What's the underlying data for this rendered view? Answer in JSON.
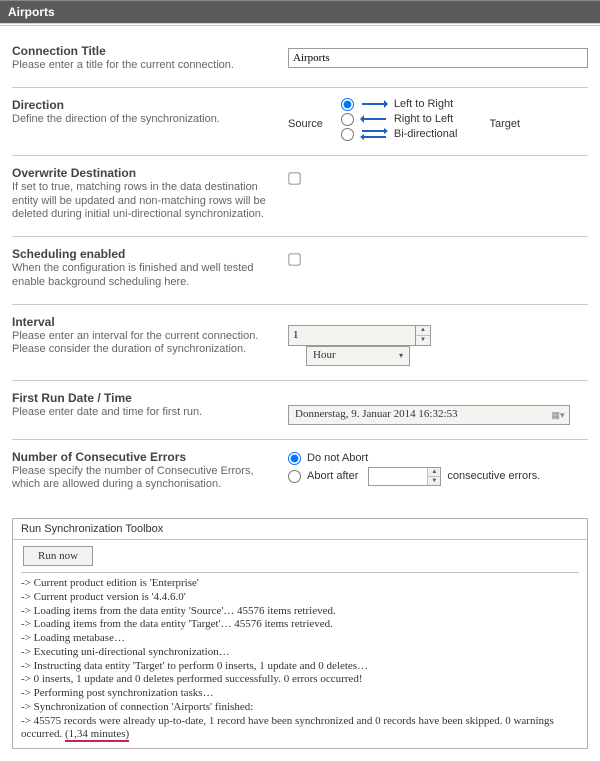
{
  "title": "Airports",
  "conn": {
    "title": "Connection Title",
    "desc": "Please enter a title for the current connection.",
    "value": "Airports"
  },
  "dir": {
    "title": "Direction",
    "desc": "Define the direction of the synchronization.",
    "source": "Source",
    "target": "Target",
    "opts": {
      "ltr": "Left to Right",
      "rtl": "Right to Left",
      "bi": "Bi-directional"
    }
  },
  "over": {
    "title": "Overwrite Destination",
    "desc": "If set to true, matching rows in the data destination entity will be updated and non-matching rows will be deleted during initial uni-directional synchronization."
  },
  "sched": {
    "title": "Scheduling enabled",
    "desc": "When the configuration is finished and well tested enable background scheduling here."
  },
  "interval": {
    "title": "Interval",
    "desc": "Please enter an interval for the current connection. Please consider the duration of synchronization.",
    "value": "1",
    "unit": "Hour"
  },
  "first": {
    "title": "First Run Date / Time",
    "desc": "Please enter date and time for first run.",
    "value": "Donnerstag,   9.   Januar    2014 16:32:53"
  },
  "errs": {
    "title": "Number of Consecutive Errors",
    "desc": "Please specify the number of Consecutive Errors, which are allowed during a synchonisation.",
    "opts": {
      "no": "Do not Abort",
      "after": "Abort after"
    },
    "suffix": "consecutive errors."
  },
  "toolbox": {
    "title": "Run Synchronization Toolbox",
    "button": "Run now",
    "log": [
      "-> Current product edition is 'Enterprise'",
      "-> Current product version is '4.4.6.0'",
      "-> Loading items from the data entity 'Source'… 45576 items retrieved.",
      "-> Loading items from the data entity 'Target'… 45576 items retrieved.",
      "-> Loading metabase…",
      "-> Executing uni-directional synchronization…",
      "-> Instructing data entity 'Target' to perform 0 inserts, 1 update and 0 deletes…",
      "-> 0 inserts, 1 update and 0 deletes performed successfully. 0 errors occurred!",
      "-> Performing post synchronization tasks…",
      "-> Synchronization of connection 'Airports' finished:",
      "-> 45575 records were already up-to-date, 1 record have been synchronized and 0 records have been skipped. 0 warnings occurred."
    ],
    "timing": "(1,34 minutes)"
  }
}
